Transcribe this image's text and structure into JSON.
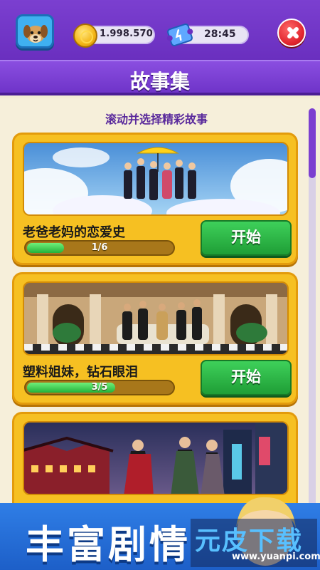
{
  "header": {
    "coins": "1.998.570",
    "timer": "28:45"
  },
  "page": {
    "title": "故事集",
    "subtitle": "滚动并选择精彩故事"
  },
  "stories": [
    {
      "title": "老爸老妈的恋爱史",
      "progress_text": "1/6",
      "progress": 0.167,
      "button": "开始"
    },
    {
      "title": "塑料姐妹，钻石眼泪",
      "progress_text": "3/5",
      "progress": 0.6,
      "button": "开始"
    }
  ],
  "banner": {
    "text": "丰富剧情",
    "watermark": "元皮下载",
    "watermark_url": "www.yuanpi.com"
  },
  "icons": {
    "avatar": "dog-avatar-icon",
    "coin": "coin-icon",
    "ticket": "ticket-icon",
    "close": "close-icon"
  },
  "colors": {
    "header_purple": "#6a2fbf",
    "card_gold": "#f6c022",
    "start_green": "#1f9e36",
    "close_red": "#e0242c"
  }
}
